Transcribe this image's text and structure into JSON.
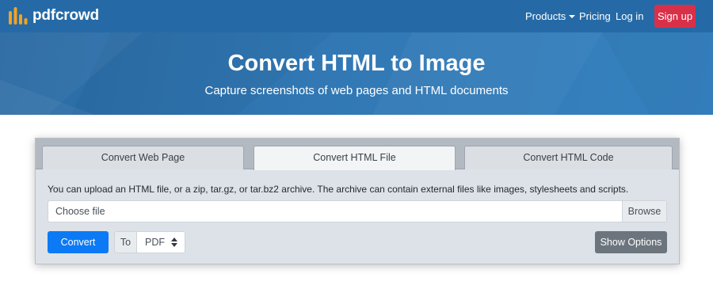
{
  "brand": {
    "name": "pdfcrowd",
    "logo_color": "#f4a321"
  },
  "nav": {
    "products": "Products",
    "pricing": "Pricing",
    "login": "Log in",
    "signup": "Sign up"
  },
  "hero": {
    "title": "Convert HTML to Image",
    "subtitle": "Capture screenshots of web pages and HTML documents"
  },
  "tabs": [
    {
      "label": "Convert Web Page",
      "active": false
    },
    {
      "label": "Convert HTML File",
      "active": true
    },
    {
      "label": "Convert HTML Code",
      "active": false
    }
  ],
  "upload": {
    "info": "You can upload an HTML file, or a zip, tar.gz, or tar.bz2 archive. The archive can contain external files like images, stylesheets and scripts.",
    "file_label": "Choose file",
    "browse_label": "Browse"
  },
  "actions": {
    "convert_label": "Convert",
    "to_label": "To",
    "format_value": "PDF",
    "show_options_label": "Show Options"
  },
  "colors": {
    "nav_bg": "#256aa6",
    "signup_bg": "#d9304a",
    "convert_bg": "#0d7af5",
    "show_options_bg": "#6c757d"
  }
}
